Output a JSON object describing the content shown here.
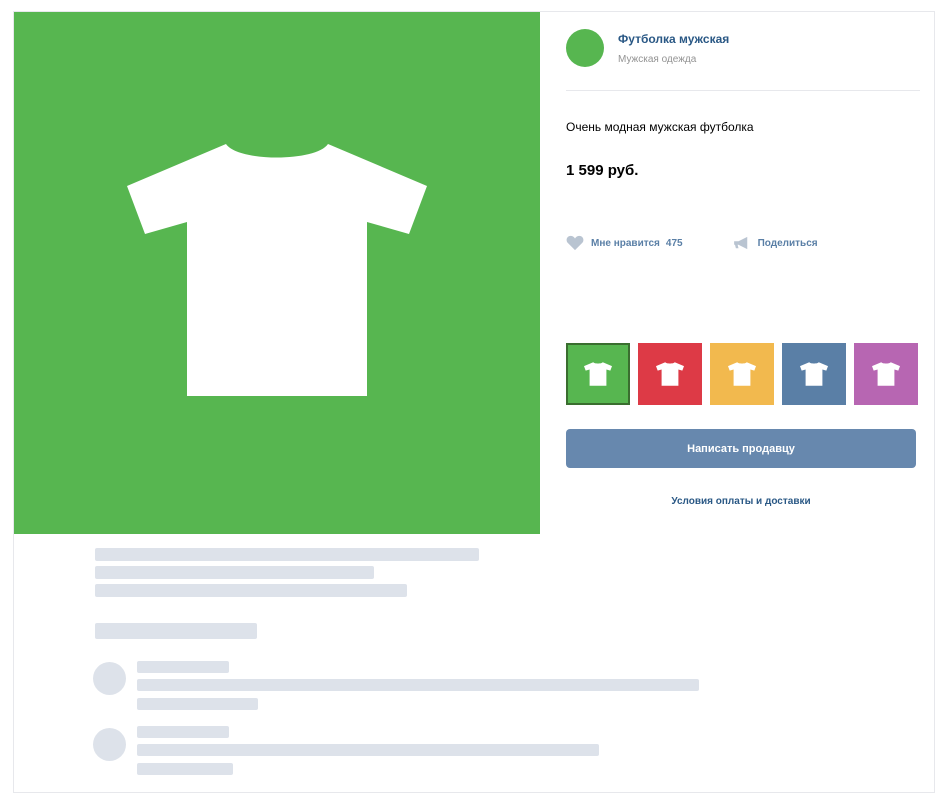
{
  "product": {
    "seller_name": "Футболка мужская",
    "seller_category": "Мужская одежда",
    "description": "Очень модная мужская футболка",
    "price": "1 599 руб.",
    "like_label": "Мне нравится",
    "like_count": "475",
    "share_label": "Поделиться",
    "contact_button": "Написать продавцу",
    "terms_link": "Условия оплаты и доставки"
  },
  "colors": {
    "hero": "#57b650",
    "swatches": [
      "#57b650",
      "#dd3a46",
      "#f2b94e",
      "#5a7fa6",
      "#b766b2"
    ],
    "selected_swatch_index": 0,
    "button": "#6788ae",
    "skeleton": "#dde2ea"
  },
  "icons": {
    "hero": "t-shirt-icon",
    "like": "heart-icon",
    "share": "megaphone-icon",
    "swatch": "t-shirt-icon"
  }
}
